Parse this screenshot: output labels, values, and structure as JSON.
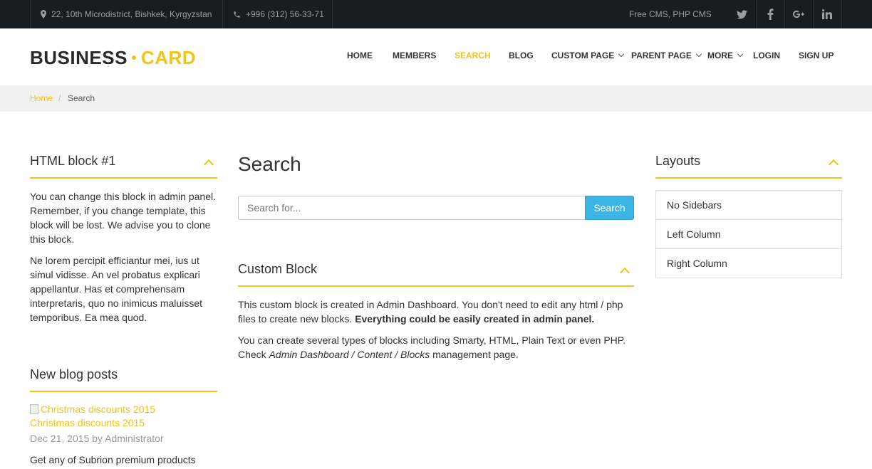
{
  "topbar": {
    "address": "22, 10th Microdistrict, Bishkek, Kyrgyzstan",
    "phone": "+996 (312) 56-33-71",
    "tagline": "Free CMS, PHP CMS",
    "social_icons": [
      "twitter-icon",
      "facebook-icon",
      "google-plus-icon",
      "linkedin-icon"
    ]
  },
  "brand": {
    "logo_part1": "BUSINESS",
    "logo_part2": "CARD",
    "accent_color": "#f0c419",
    "button_color": "#3cb4e5"
  },
  "nav": {
    "items": [
      {
        "label": "HOME"
      },
      {
        "label": "MEMBERS"
      },
      {
        "label": "SEARCH",
        "active": true
      },
      {
        "label": "BLOG"
      },
      {
        "label": "CUSTOM PAGE"
      },
      {
        "label": "PARENT PAGE"
      },
      {
        "label": "MORE"
      },
      {
        "label": "LOGIN"
      },
      {
        "label": "SIGN UP"
      }
    ]
  },
  "breadcrumb": {
    "home": "Home",
    "separator": "/",
    "current": "Search"
  },
  "left": {
    "html_block": {
      "title": "HTML block #1",
      "para1": "You can change this block in admin panel. Remember, if you change template, this block will be lost. We advise you to clone this block.",
      "para2": "Ne lorem percipit efficiantur mei, ius ut simul vidisse. An vel probatus explicari appellantur. Has et comprehensam interpretaris, quo no inimicus maluisset temporibus. Ea mea quod."
    },
    "blog": {
      "title": "New blog posts",
      "post_image_alt": "Christmas discounts 2015",
      "post_title": "Christmas discounts 2015",
      "post_meta": "Dec 21, 2015 by Administrator",
      "post_excerpt": "Get any of Subrion premium products"
    }
  },
  "main": {
    "title": "Search",
    "search_placeholder": "Search for...",
    "search_button": "Search",
    "custom_block": {
      "title": "Custom Block",
      "p1_text": "This custom block is created in Admin Dashboard. You don't need to edit any html / php files to create new blocks.",
      "p1_bold": "Everything could be easily created in admin panel.",
      "p2_text": "You can create several types of blocks including Smarty, HTML, Plain Text or even PHP. Check",
      "p2_italic": "Admin Dashboard / Content / Blocks",
      "p2_end": "management page."
    }
  },
  "right": {
    "layouts": {
      "title": "Layouts",
      "items": [
        "No Sidebars",
        "Left Column",
        "Right Column"
      ]
    }
  }
}
